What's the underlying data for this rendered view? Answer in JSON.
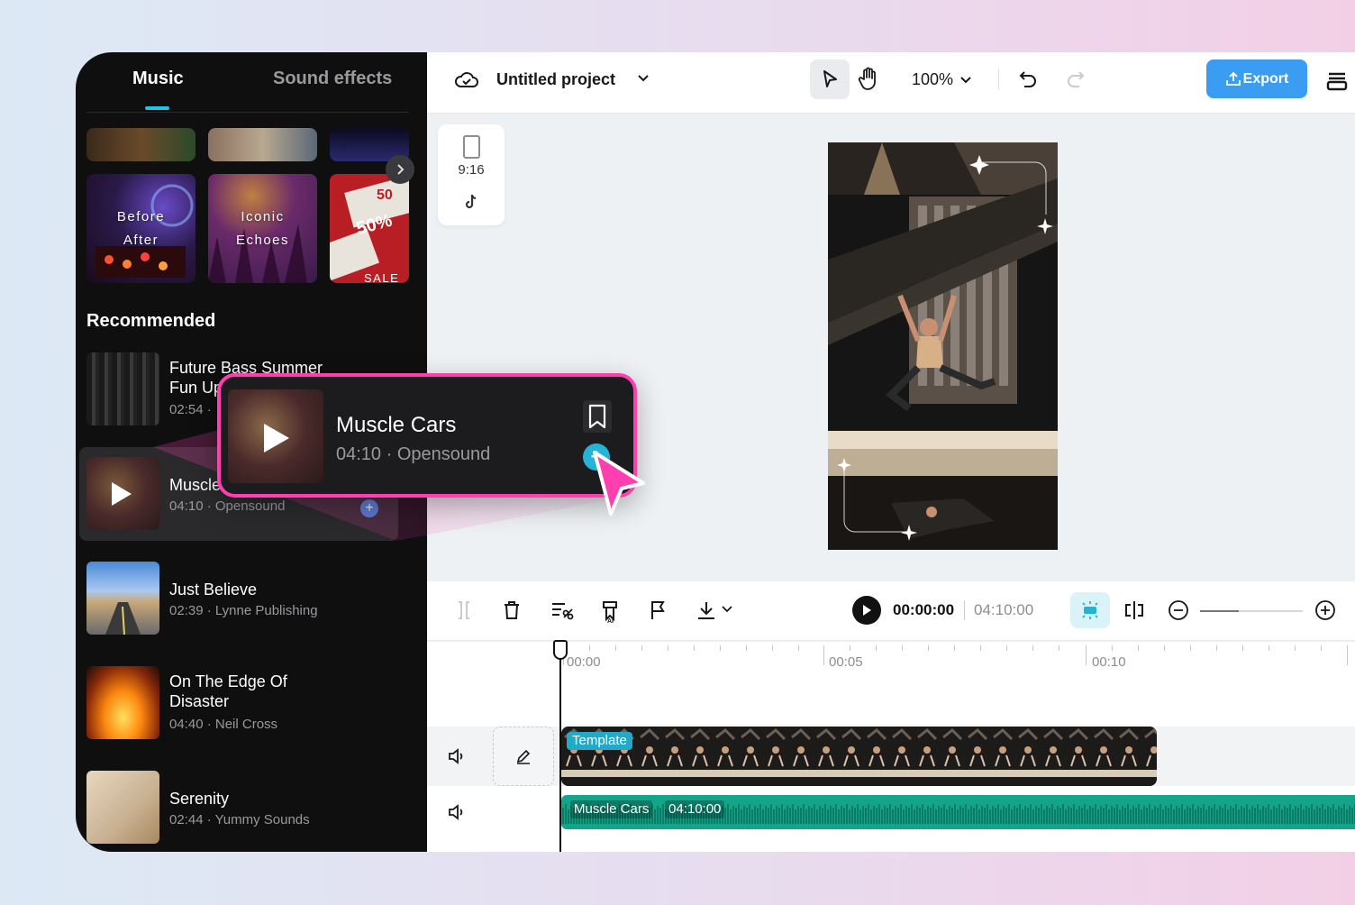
{
  "tabs": {
    "music": "Music",
    "sound_effects": "Sound effects"
  },
  "featured": [
    {
      "label_line1": "Before",
      "label_line2": "After"
    },
    {
      "label_line1": "Iconic",
      "label_line2": "Echoes"
    },
    {
      "label_line1": "50%",
      "label_line2": "SALE"
    }
  ],
  "recommended": {
    "title": "Recommended",
    "tracks": [
      {
        "name": "Future Bass Summer Fun Up",
        "meta": "02:54 · "
      },
      {
        "name": "Muscle Cars",
        "meta": "04:10 · Opensound"
      },
      {
        "name": "Just Believe",
        "meta": "02:39 · Lynne Publishing"
      },
      {
        "name": "On The Edge Of Disaster",
        "meta": "04:40 · Neil Cross"
      },
      {
        "name": "Serenity",
        "meta": "02:44 · Yummy Sounds"
      }
    ]
  },
  "popup": {
    "name": "Muscle Cars",
    "meta": "04:10 · Opensound",
    "add_icon": "plus"
  },
  "header": {
    "project": "Untitled project",
    "zoom": "100%",
    "export": "Export"
  },
  "aspect": {
    "ratio": "9:16"
  },
  "timeline": {
    "current_time": "00:00:00",
    "total_time": "04:10:00",
    "ruler": [
      "00:00",
      "00:05",
      "00:10"
    ],
    "video_clip_label": "Template",
    "audio_clip_name": "Muscle Cars",
    "audio_clip_duration": "04:10:00",
    "zoom_level": 0.38
  },
  "colors": {
    "accent": "#20c4e6",
    "export": "#3a9df2",
    "popup_border": "#ff3fb0",
    "audio": "#13a58a"
  }
}
